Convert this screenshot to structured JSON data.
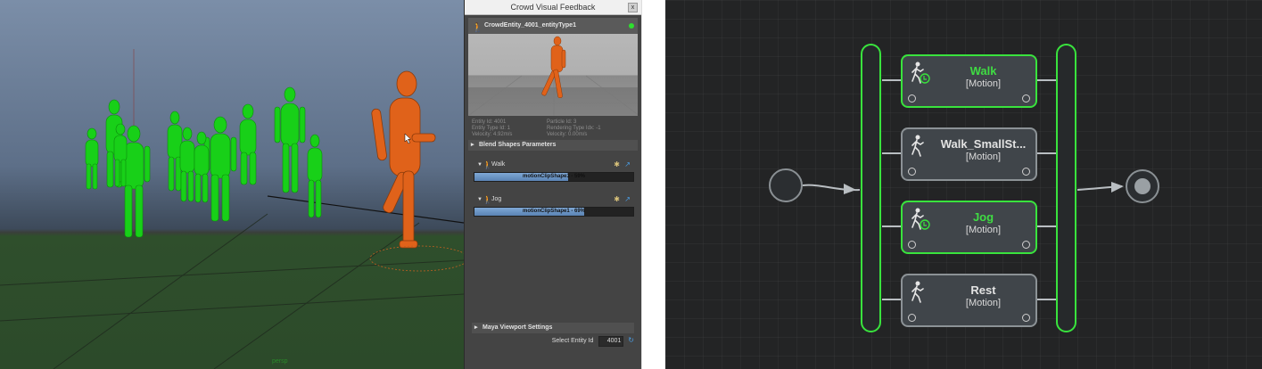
{
  "viewport": {
    "camera_label": "persp"
  },
  "panel": {
    "title": "Crowd Visual Feedback",
    "close_label": "x",
    "entity_name": "CrowdEntity_4001_entityType1",
    "stats": [
      "Entity Id: 4001",
      "Particle Id: 3",
      "Entity Type Id: 1",
      "Rendering Type Idx: -1",
      "Velocity: 4.92m/s",
      "Velocity: 0.00m/s"
    ],
    "blend_section": "Blend Shapes Parameters",
    "clips": [
      {
        "label": "Walk",
        "bar_text": "motionClipShape3 - 59%",
        "fill": 0.59
      },
      {
        "label": "Jog",
        "bar_text": "motionClipShape1 - 69%",
        "fill": 0.69
      }
    ],
    "viewport_section": "Maya Viewport Settings",
    "select_label": "Select Entity Id",
    "select_value": "4001"
  },
  "graph": {
    "states": [
      {
        "name": "Walk",
        "type": "[Motion]",
        "active": true
      },
      {
        "name": "Walk_SmallSt...",
        "type": "[Motion]",
        "active": false
      },
      {
        "name": "Jog",
        "type": "[Motion]",
        "active": true
      },
      {
        "name": "Rest",
        "type": "[Motion]",
        "active": false
      }
    ],
    "colors": {
      "active": "#39e33d",
      "inactive": "#8c9296",
      "node": "#40454a",
      "bg": "#232425"
    }
  }
}
